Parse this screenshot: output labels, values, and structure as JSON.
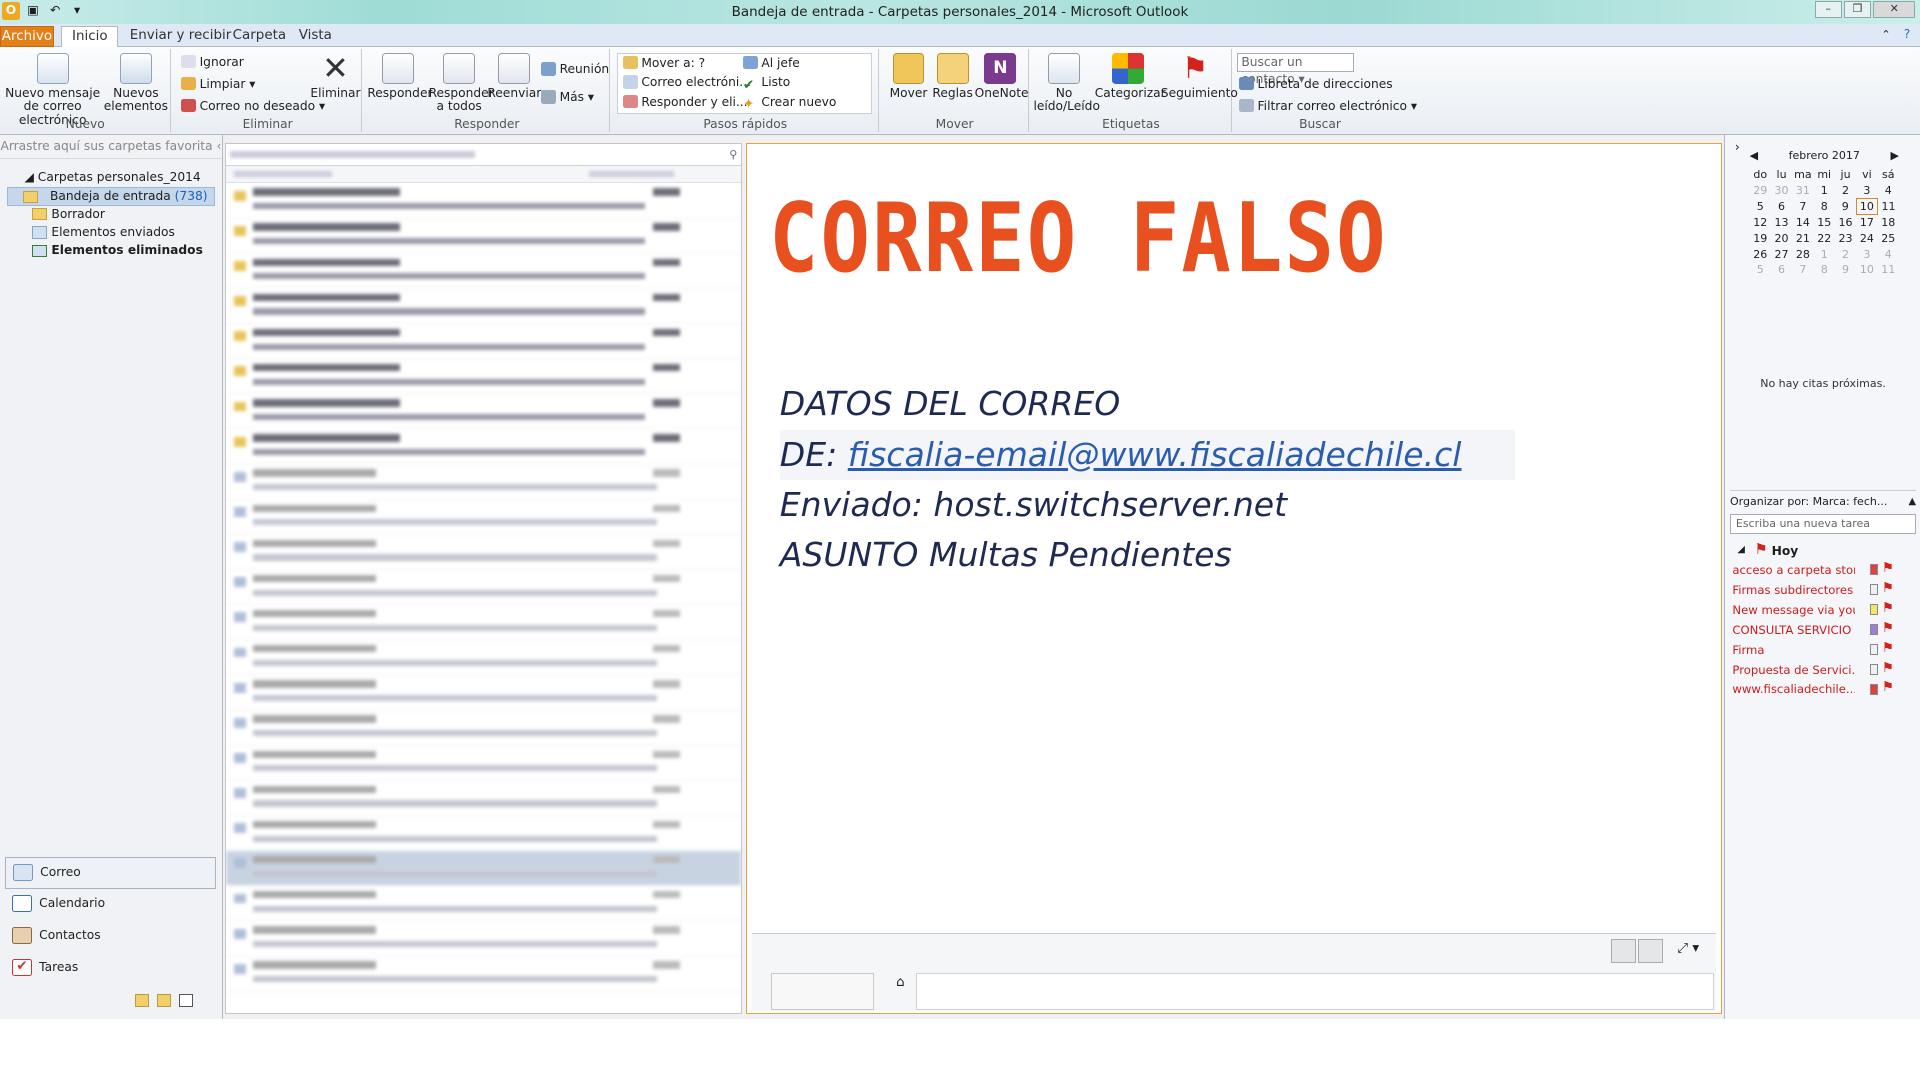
{
  "window": {
    "title": "Bandeja de entrada - Carpetas personales_2014 - Microsoft Outlook"
  },
  "tabs": [
    "Archivo",
    "Inicio",
    "Enviar y recibir",
    "Carpeta",
    "Vista"
  ],
  "ribbon": {
    "nuevo": {
      "group": "Nuevo",
      "new_mail": "Nuevo mensaje de correo electrónico",
      "new_items": "Nuevos elementos"
    },
    "eliminar": {
      "group": "Eliminar",
      "ignore": "Ignorar",
      "clean": "Limpiar",
      "junk": "Correo no deseado",
      "delete": "Eliminar"
    },
    "responder": {
      "group": "Responder",
      "reply": "Responder",
      "reply_all": "Responder a todos",
      "forward": "Reenviar",
      "meeting": "Reunión",
      "more": "Más"
    },
    "pasos": {
      "group": "Pasos rápidos",
      "items": [
        "Mover a: ?",
        "Correo electróni...",
        "Responder y eli...",
        "Al jefe",
        "Listo",
        "Crear nuevo"
      ]
    },
    "mover": {
      "group": "Mover",
      "move": "Mover",
      "rules": "Reglas",
      "onenote": "OneNote"
    },
    "etiquetas": {
      "group": "Etiquetas",
      "unread": "No leído/Leído",
      "categorize": "Categorizar",
      "followup": "Seguimiento"
    },
    "buscar": {
      "group": "Buscar",
      "contact_search": "Buscar un contacto",
      "address_book": "Libreta de direcciones",
      "filter": "Filtrar correo electrónico"
    }
  },
  "nav": {
    "favorites": "Arrastre aquí sus carpetas favorita",
    "root": "Carpetas personales_2014",
    "folders": [
      {
        "name": "Bandeja de entrada",
        "count": "(738)"
      },
      {
        "name": "Borrador"
      },
      {
        "name": "Elementos enviados"
      },
      {
        "name": "Elementos eliminados"
      }
    ],
    "buttons": [
      "Correo",
      "Calendario",
      "Contactos",
      "Tareas"
    ]
  },
  "message": {
    "headline": "CORREO FALSO",
    "l1": "DATOS DEL CORREO",
    "de_label": "DE:",
    "de_email": "fiscalia-email@www.fiscaliadechile.cl",
    "l3": "Enviado: host.switchserver.net",
    "l4": "ASUNTO Multas Pendientes"
  },
  "calendar": {
    "month": "febrero 2017",
    "days": [
      "do",
      "lu",
      "ma",
      "mi",
      "ju",
      "vi",
      "sá"
    ],
    "weeks": [
      [
        "29",
        "30",
        "31",
        "1",
        "2",
        "3",
        "4"
      ],
      [
        "5",
        "6",
        "7",
        "8",
        "9",
        "10",
        "11"
      ],
      [
        "12",
        "13",
        "14",
        "15",
        "16",
        "17",
        "18"
      ],
      [
        "19",
        "20",
        "21",
        "22",
        "23",
        "24",
        "25"
      ],
      [
        "26",
        "27",
        "28",
        "1",
        "2",
        "3",
        "4"
      ],
      [
        "5",
        "6",
        "7",
        "8",
        "9",
        "10",
        "11"
      ]
    ]
  },
  "no_appts": "No hay citas próximas.",
  "tasks": {
    "organize": "Organizar por: Marca: fech...",
    "new_task": "Escriba una nueva tarea",
    "group": "Hoy",
    "items": [
      "acceso a carpeta stor...",
      "Firmas subdirectores",
      "New message via you...",
      "CONSULTA SERVICIO ...",
      "Firma",
      "Propuesta de Servici...",
      "www.fiscaliadechile...."
    ]
  }
}
